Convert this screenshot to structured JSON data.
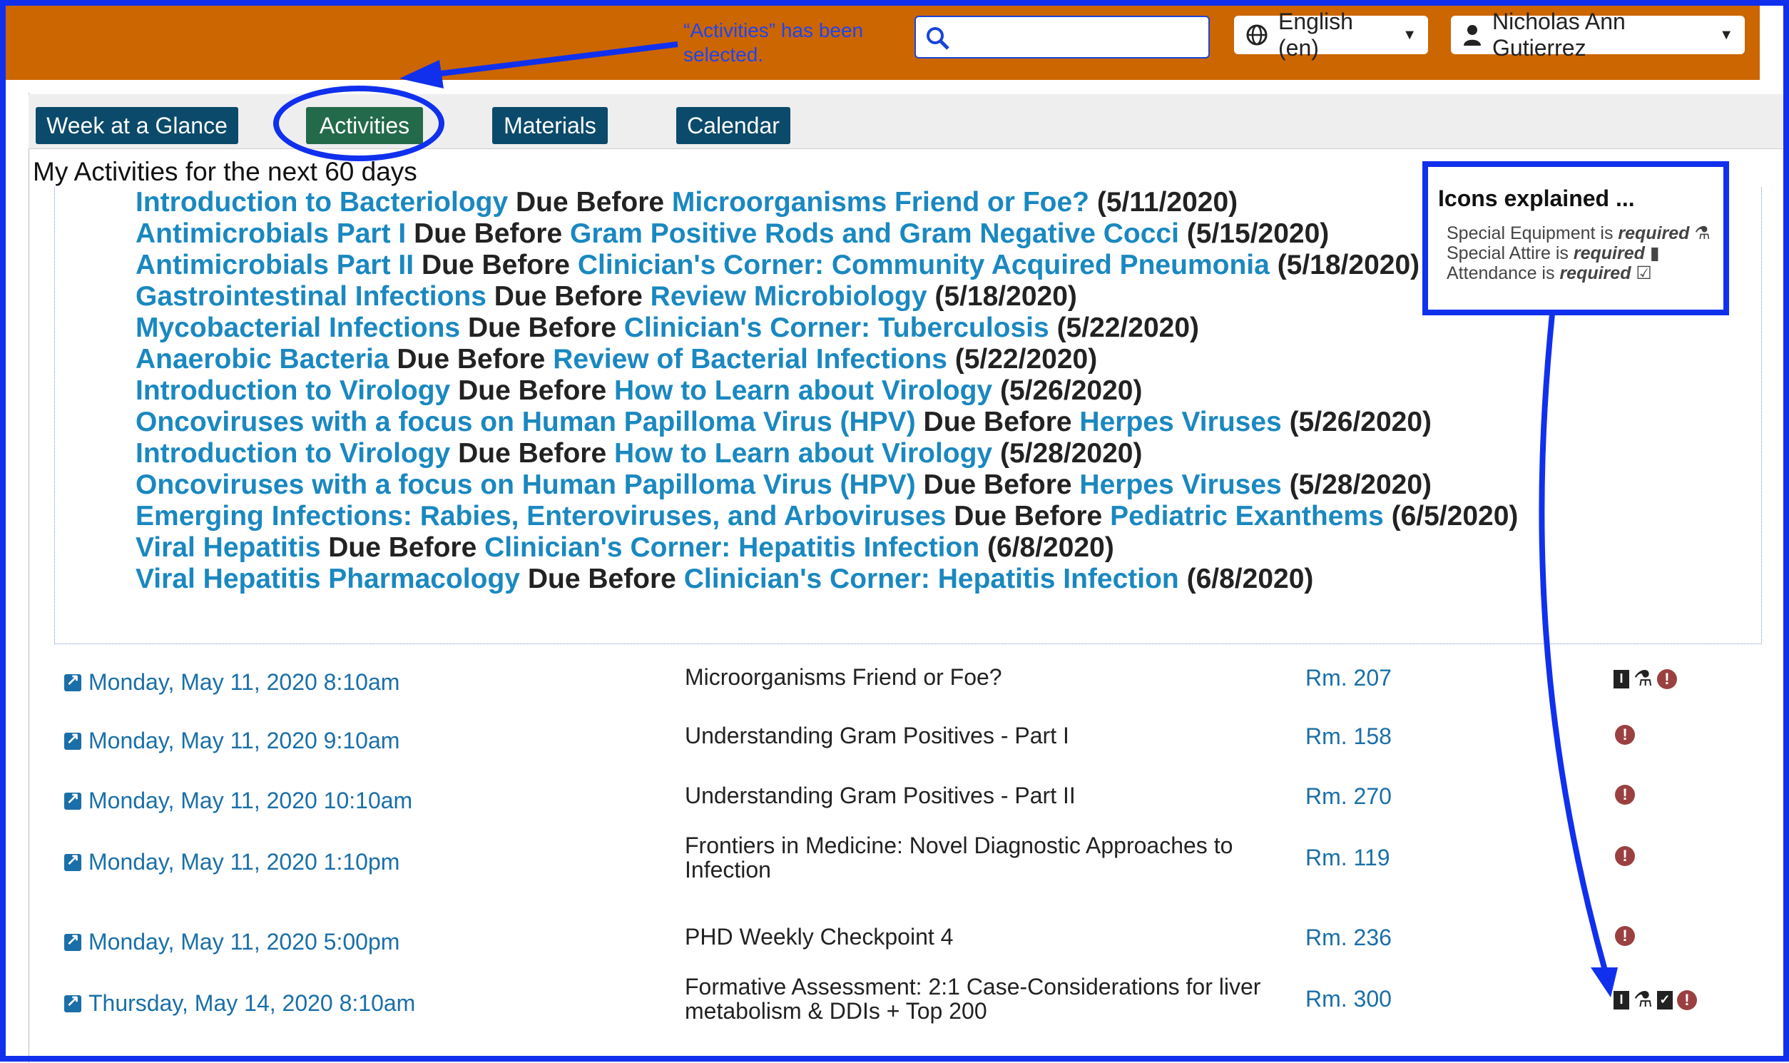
{
  "header": {
    "annotation": "“Activities” has been selected.",
    "search_placeholder": "",
    "language": "English (en)",
    "user": "Nicholas Ann Gutierrez"
  },
  "tabs": [
    {
      "label": "Week at a Glance"
    },
    {
      "label": "Activities"
    },
    {
      "label": "Materials"
    },
    {
      "label": "Calendar"
    }
  ],
  "activities": {
    "title": "My Activities for the next 60 days",
    "due_label": "Due Before",
    "items": [
      {
        "name": "Introduction to Bacteriology",
        "before": "Microorganisms Friend or Foe?",
        "date": "(5/11/2020)"
      },
      {
        "name": "Antimicrobials Part I",
        "before": "Gram Positive Rods and Gram Negative Cocci",
        "date": "(5/15/2020)"
      },
      {
        "name": "Antimicrobials Part II",
        "before": "Clinician's Corner: Community Acquired Pneumonia",
        "date": "(5/18/2020)"
      },
      {
        "name": "Gastrointestinal Infections",
        "before": "Review Microbiology",
        "date": "(5/18/2020)"
      },
      {
        "name": "Mycobacterial Infections",
        "before": "Clinician's Corner: Tuberculosis",
        "date": "(5/22/2020)"
      },
      {
        "name": "Anaerobic Bacteria",
        "before": "Review of Bacterial Infections",
        "date": "(5/22/2020)"
      },
      {
        "name": "Introduction to Virology",
        "before": "How to Learn about Virology",
        "date": "(5/26/2020)"
      },
      {
        "name": "Oncoviruses with a focus on Human Papilloma Virus (HPV)",
        "before": "Herpes Viruses",
        "date": "(5/26/2020)"
      },
      {
        "name": "Introduction to Virology",
        "before": "How to Learn about Virology",
        "date": "(5/28/2020)"
      },
      {
        "name": "Oncoviruses with a focus on Human Papilloma Virus (HPV)",
        "before": "Herpes Viruses",
        "date": "(5/28/2020)"
      },
      {
        "name": "Emerging Infections: Rabies, Enteroviruses, and Arboviruses",
        "before": "Pediatric Exanthems",
        "date": "(6/5/2020)"
      },
      {
        "name": "Viral Hepatitis",
        "before": "Clinician's Corner: Hepatitis Infection",
        "date": "(6/8/2020)"
      },
      {
        "name": "Viral Hepatitis Pharmacology",
        "before": "Clinician's Corner: Hepatitis Infection",
        "date": "(6/8/2020)"
      }
    ]
  },
  "icons_explained": {
    "title": "Icons explained ...",
    "lines": [
      {
        "text": "Special Equipment is ",
        "em": "required",
        "icon": "flask-icon"
      },
      {
        "text": "Special Attire is ",
        "em": "required",
        "icon": "attire-icon"
      },
      {
        "text": "Attendance is ",
        "em": "required",
        "icon": "calendar-check-icon"
      }
    ]
  },
  "schedule": [
    {
      "date": "Monday, May 11, 2020 8:10am",
      "title": "Microorganisms Friend or Foe?",
      "room": "Rm. 207",
      "icons": [
        "attire-icon",
        "flask-icon",
        "warning-icon"
      ]
    },
    {
      "date": "Monday, May 11, 2020 9:10am",
      "title": "Understanding Gram Positives - Part I",
      "room": "Rm. 158",
      "icons": [
        "warning-icon"
      ]
    },
    {
      "date": "Monday, May 11, 2020 10:10am",
      "title": "Understanding Gram Positives - Part II",
      "room": "Rm. 270",
      "icons": [
        "warning-icon"
      ]
    },
    {
      "date": "Monday, May 11, 2020 1:10pm",
      "title": "Frontiers in Medicine: Novel Diagnostic Approaches to Infection",
      "room": "Rm. 119",
      "icons": [
        "warning-icon"
      ]
    },
    {
      "date": "Monday, May 11, 2020 5:00pm",
      "title": "PHD Weekly Checkpoint 4",
      "room": "Rm. 236",
      "icons": [
        "warning-icon"
      ]
    },
    {
      "date": "Thursday, May 14, 2020 8:10am",
      "title": "Formative Assessment: 2:1 Case-Considerations for liver metabolism & DDIs + Top 200",
      "room": "Rm. 300",
      "icons": [
        "attire-icon",
        "flask-icon",
        "calendar-check-icon",
        "warning-icon"
      ]
    }
  ],
  "colors": {
    "header": "#cc6600",
    "tab": "#0b4a6b",
    "tab_active": "#236a4a",
    "link": "#1a88c0",
    "annotation": "#1030ee"
  }
}
